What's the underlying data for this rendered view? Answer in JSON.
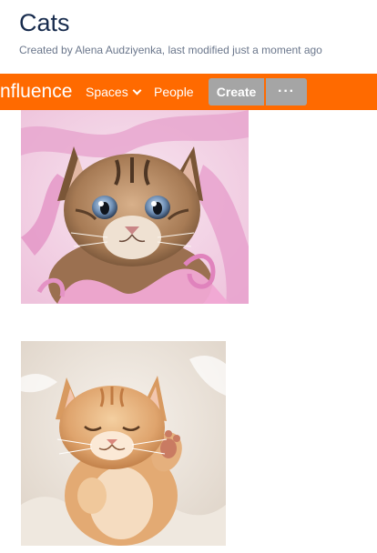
{
  "page": {
    "title": "Cats",
    "byline": "Created by Alena Audziyenka, last modified just a moment ago"
  },
  "header": {
    "brand": "nfluence",
    "nav": {
      "spaces_label": "Spaces",
      "people_label": "People"
    },
    "create_label": "Create",
    "more_label": "···",
    "bar_color": "#ff6a00",
    "button_color": "#a5a5a5"
  },
  "content": {
    "images": [
      {
        "subject": "tabby kitten with pink ribbon"
      },
      {
        "subject": "sleeping ginger kitten on white fur"
      }
    ]
  }
}
